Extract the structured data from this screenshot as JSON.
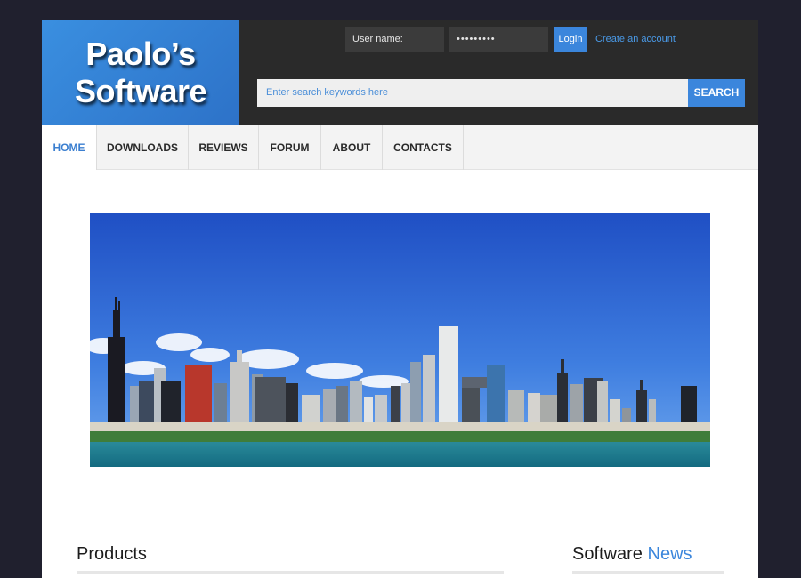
{
  "logo": {
    "text": "Paolo’s\nSoftware"
  },
  "auth": {
    "username_placeholder": "User name:",
    "password_mask": "•••••••••",
    "login_label": "Login",
    "create_account_label": "Create an account"
  },
  "search": {
    "placeholder": "Enter search keywords here",
    "button_label": "SEARCH"
  },
  "nav": {
    "items": [
      {
        "label": "HOME",
        "active": true
      },
      {
        "label": "DOWNLOADS"
      },
      {
        "label": "REVIEWS"
      },
      {
        "label": "FORUM"
      },
      {
        "label": "ABOUT"
      },
      {
        "label": "CONTACTS"
      }
    ]
  },
  "sections": {
    "products_title": "Products",
    "news_title_part1": "Software",
    "news_title_part2": "News"
  },
  "colors": {
    "accent": "#3b86dc",
    "background": "#20202e",
    "topbar": "#2a2a2a"
  },
  "icons": {
    "hero": "city-skyline-image"
  }
}
